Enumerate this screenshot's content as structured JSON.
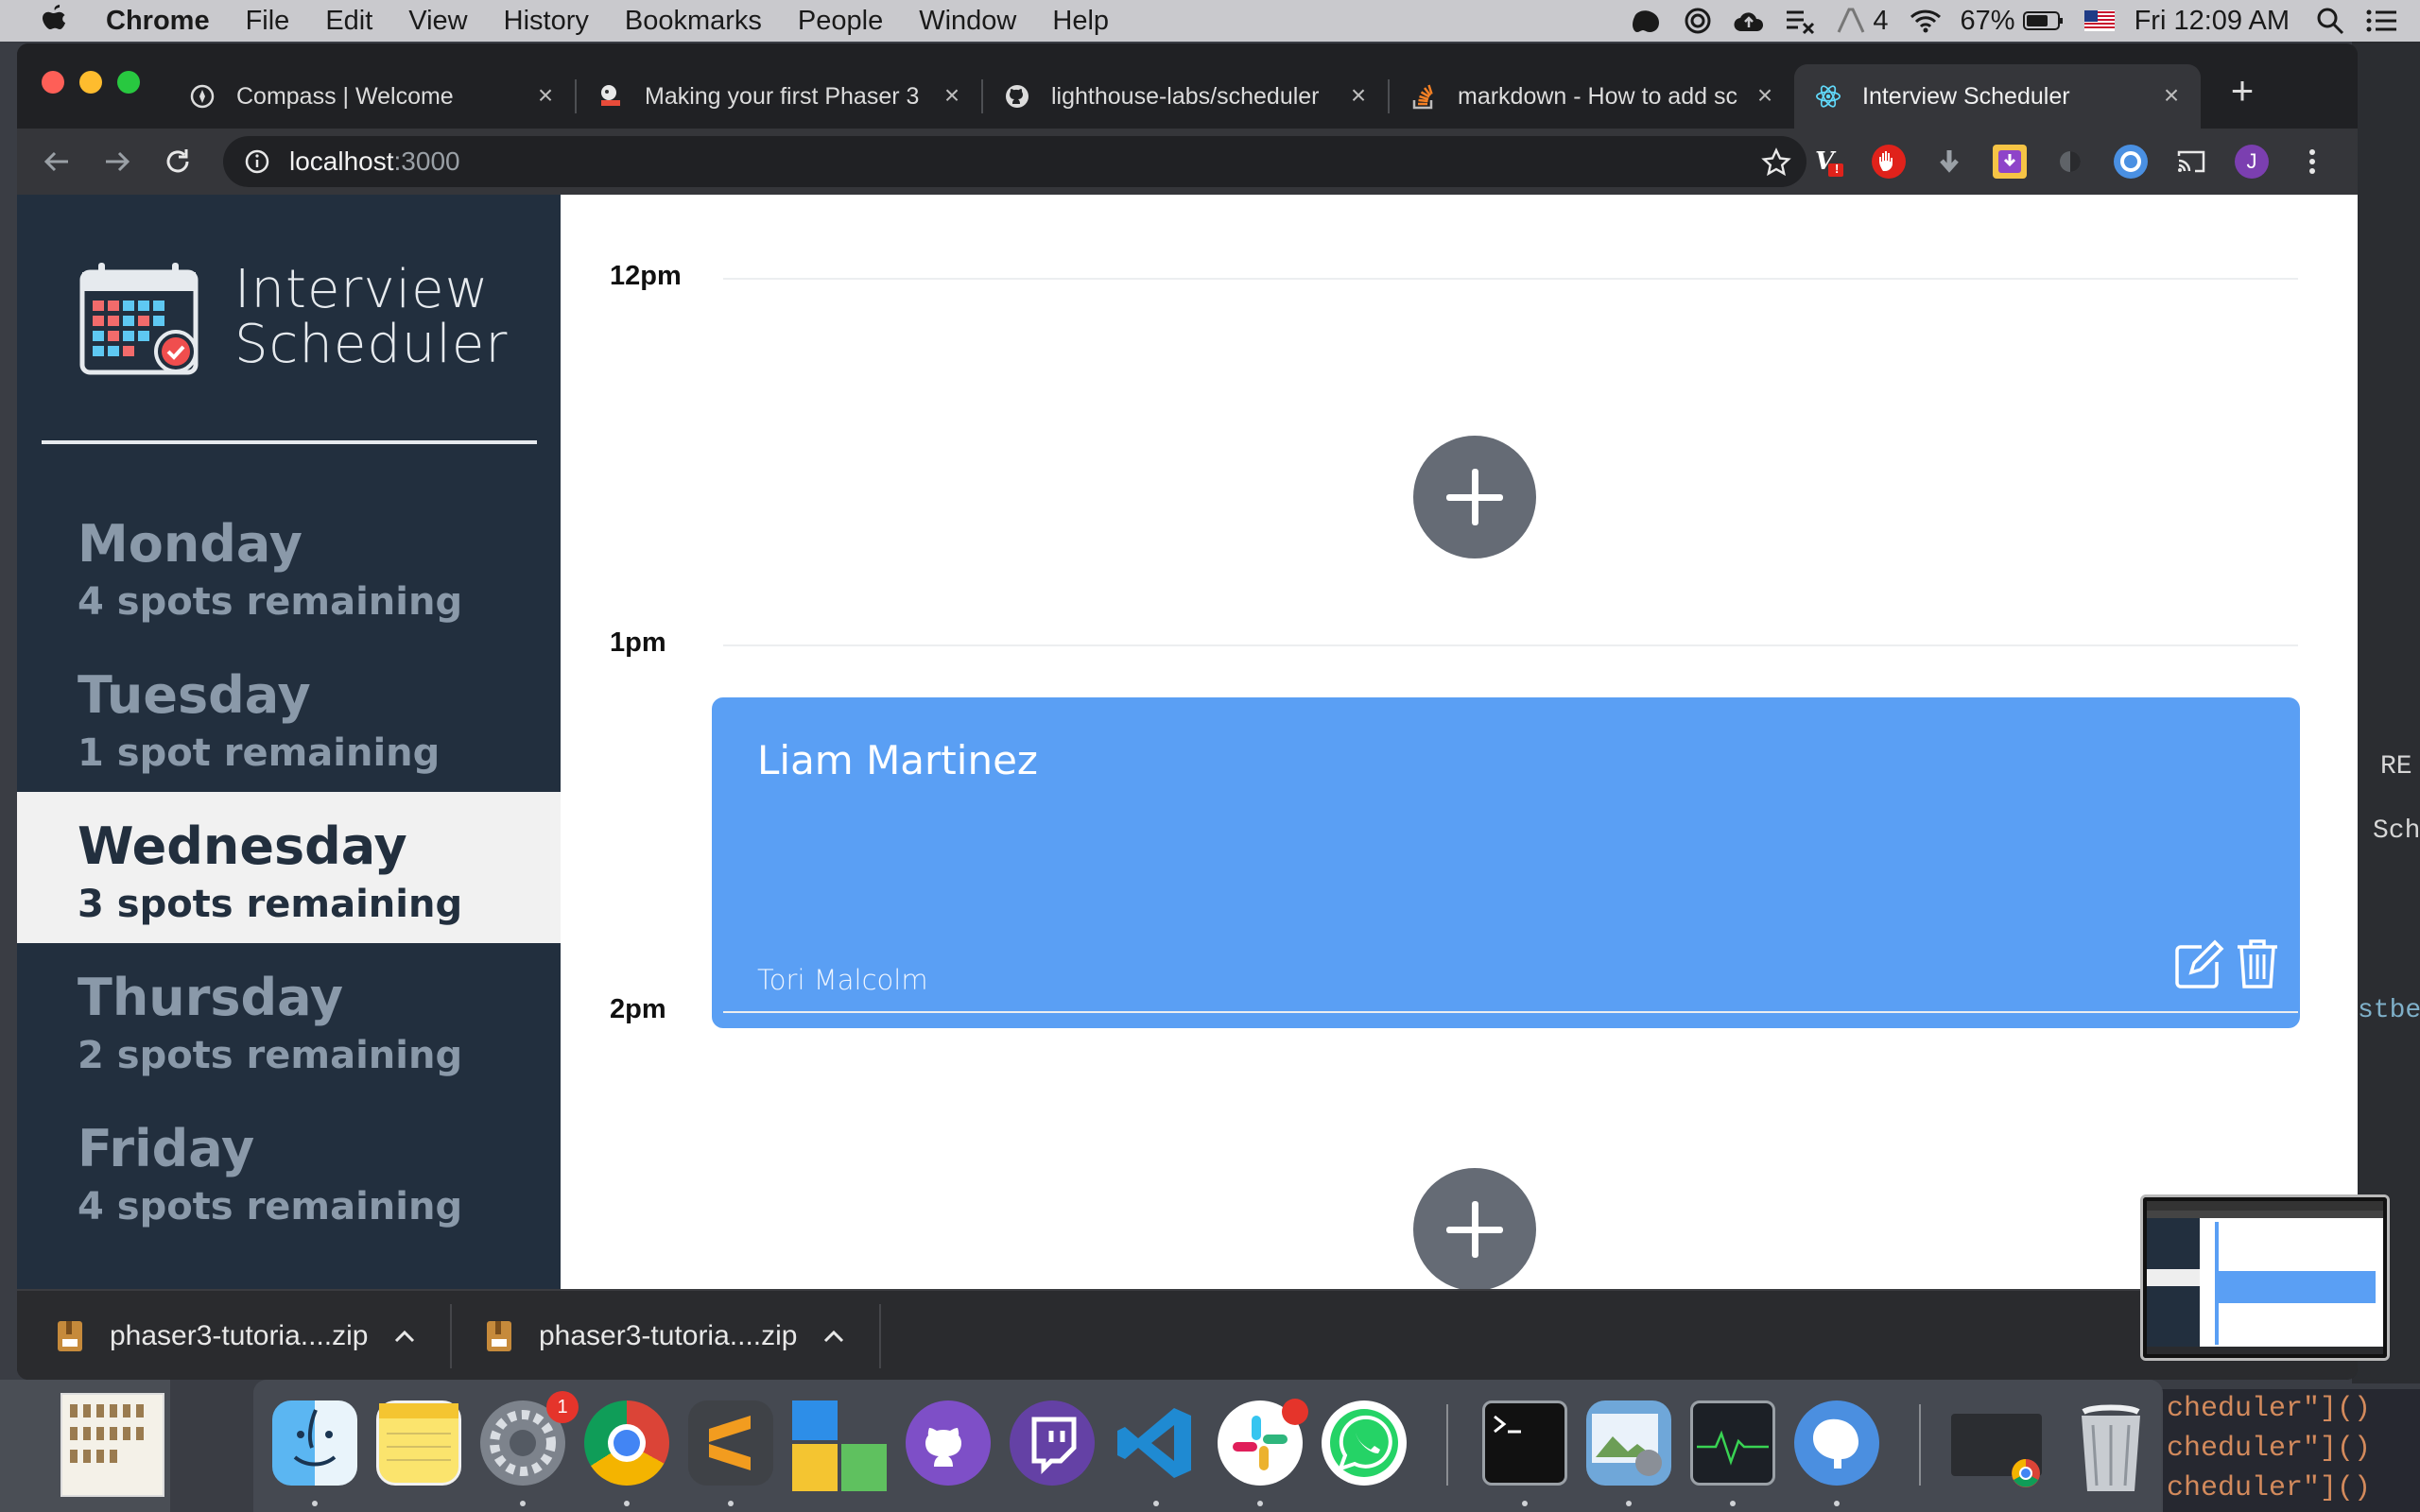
{
  "menubar": {
    "app_name": "Chrome",
    "items": [
      "File",
      "Edit",
      "View",
      "History",
      "Bookmarks",
      "People",
      "Window",
      "Help"
    ],
    "status": {
      "badge_count": "4",
      "battery": "67%",
      "clock": "Fri 12:09 AM"
    }
  },
  "browser": {
    "tabs": [
      {
        "title": "Compass | Welcome",
        "icon": "compass-icon"
      },
      {
        "title": "Making your first Phaser 3",
        "icon": "phaser-icon"
      },
      {
        "title": "lighthouse-labs/scheduler",
        "icon": "github-icon"
      },
      {
        "title": "markdown - How to add sc",
        "icon": "stackoverflow-icon"
      },
      {
        "title": "Interview Scheduler",
        "icon": "react-icon",
        "active": true
      }
    ],
    "url": {
      "host": "localhost",
      "port": ":3000"
    },
    "profile_initial": "J",
    "ext_badge": "!"
  },
  "app": {
    "title_line1": "Interview",
    "title_line2": "Scheduler",
    "days": [
      {
        "name": "Monday",
        "spots": "4 spots remaining"
      },
      {
        "name": "Tuesday",
        "spots": "1 spot remaining"
      },
      {
        "name": "Wednesday",
        "spots": "3 spots remaining",
        "selected": true
      },
      {
        "name": "Thursday",
        "spots": "2 spots remaining"
      },
      {
        "name": "Friday",
        "spots": "4 spots remaining"
      }
    ],
    "times": [
      "12pm",
      "1pm",
      "2pm"
    ],
    "appointment": {
      "student": "Liam Martinez",
      "interviewer": "Tori Malcolm"
    },
    "colors": {
      "sidebar": "#222f3e",
      "appointment": "#5a9ff4",
      "add_button": "#656b75"
    }
  },
  "downloads": [
    {
      "name": "phaser3-tutoria....zip"
    },
    {
      "name": "phaser3-tutoria....zip"
    }
  ],
  "dock": {
    "apps": [
      "finder-icon",
      "notes-icon",
      "system-preferences-icon",
      "chrome-icon",
      "sublime-text-icon",
      "tiles-icon",
      "github-desktop-icon",
      "twitch-icon",
      "vscode-icon",
      "slack-icon",
      "whatsapp-icon",
      "terminal-icon",
      "preview-icon",
      "activity-monitor-icon",
      "tableplus-icon",
      "chrome-minimized-icon",
      "trash-icon"
    ],
    "prefs_badge": "1"
  },
  "desktop": {
    "code_lines": [
      "cheduler\"]()",
      "cheduler\"]()",
      "cheduler\"]()"
    ],
    "edge_text": [
      "stbe",
      "Sch",
      "RE"
    ]
  }
}
